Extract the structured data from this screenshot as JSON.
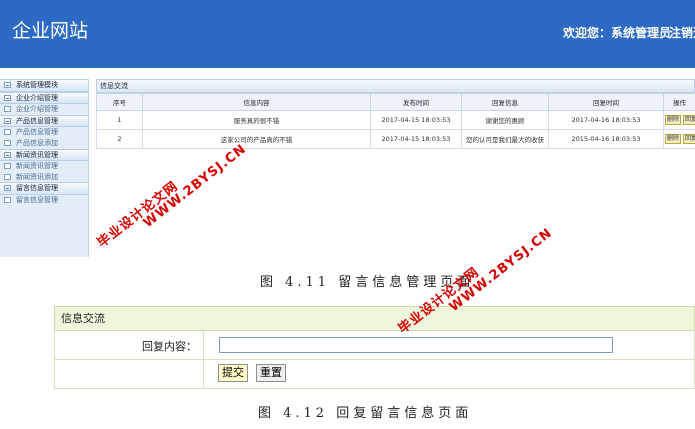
{
  "header": {
    "logo": "企业网站",
    "welcome": "欢迎您：系统管理员",
    "logout": "注销退出"
  },
  "sidebar": {
    "items": [
      {
        "label": "系统管理模块",
        "kind": "group"
      },
      {
        "label": "企业介绍管理",
        "kind": "group"
      },
      {
        "label": "企业介绍管理",
        "kind": "sub"
      },
      {
        "label": "产品信息管理",
        "kind": "group"
      },
      {
        "label": "产品信息管理",
        "kind": "sub"
      },
      {
        "label": "产品信息添加",
        "kind": "sub"
      },
      {
        "label": "新闻资讯管理",
        "kind": "group"
      },
      {
        "label": "新闻资讯管理",
        "kind": "sub"
      },
      {
        "label": "新闻资讯添加",
        "kind": "sub"
      },
      {
        "label": "留言信息管理",
        "kind": "group"
      },
      {
        "label": "留言信息管理",
        "kind": "sub"
      }
    ]
  },
  "messages": {
    "title": "信息交流",
    "columns": [
      "序号",
      "信息内容",
      "发布时间",
      "回复信息",
      "回复时间",
      "操作"
    ],
    "rows": [
      {
        "no": "1",
        "content": "服务真的很不错",
        "time": "2017-04-15 18:03:53",
        "reply": "谢谢您的惠顾",
        "reply_time": "2017-04-16 18:03:53"
      },
      {
        "no": "2",
        "content": "这家公司的产品真的不错",
        "time": "2017-04-15 18:03:53",
        "reply": "您的认可是我们最大的收获",
        "reply_time": "2015-04-16 18:03:53"
      }
    ],
    "actions": {
      "delete": "删除",
      "reply": "回复"
    }
  },
  "caption1": "图 4.11 留言信息管理页面",
  "reply_form": {
    "title": "信息交流",
    "label": "回复内容：",
    "value": "",
    "submit": "提交",
    "reset": "重置"
  },
  "caption2": "图 4.12 回复留言信息页面",
  "watermark": {
    "site": "毕业设计论文网",
    "url": "WWW.2BYSJ.CN"
  }
}
